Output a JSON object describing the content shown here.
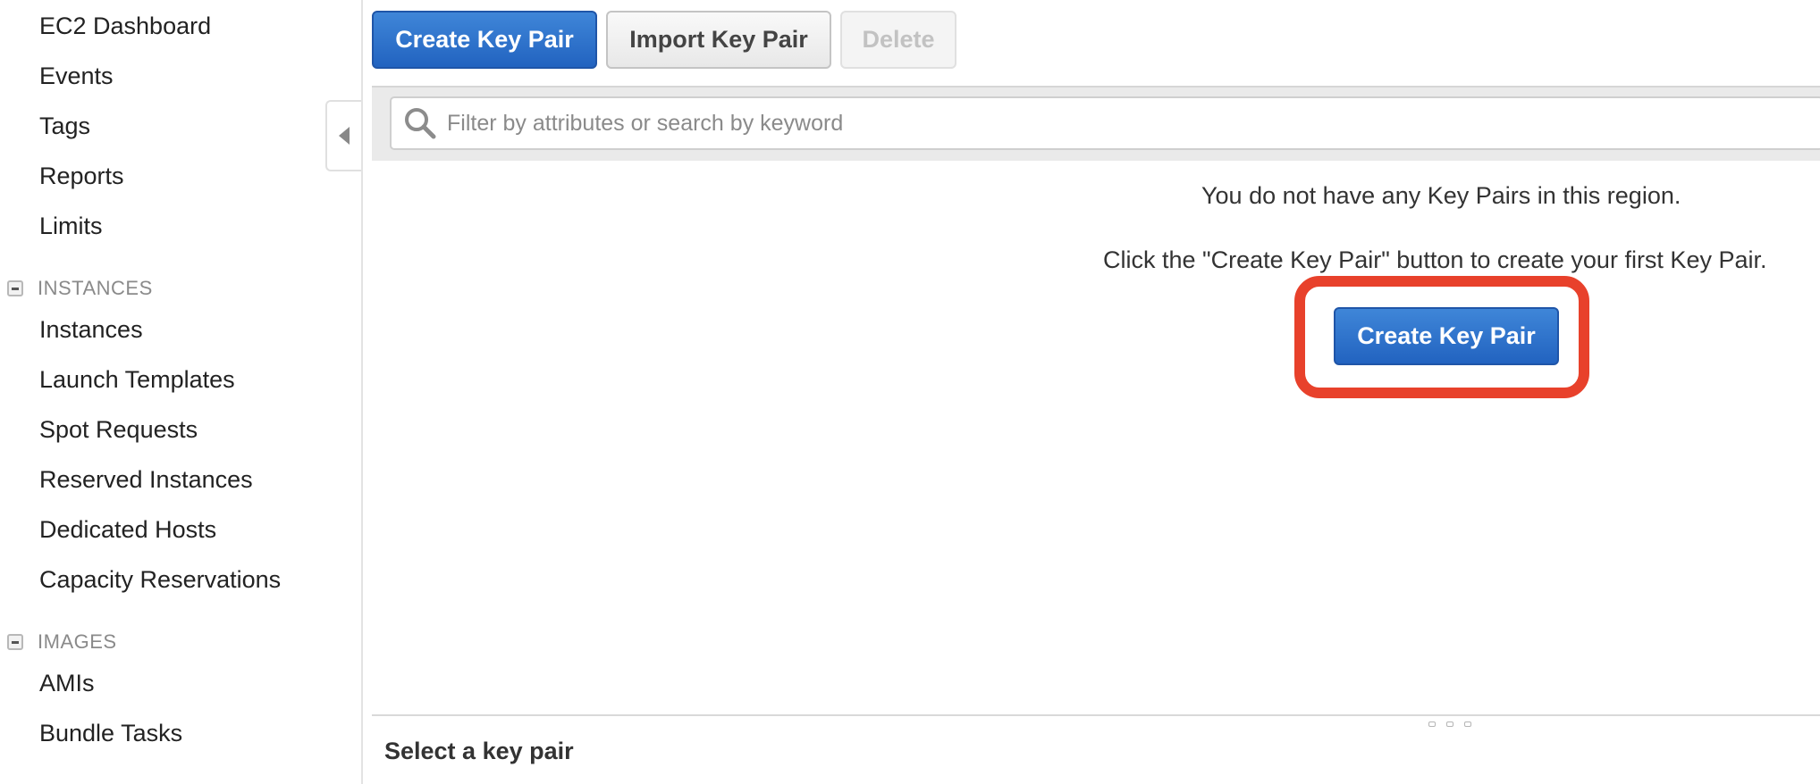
{
  "sidebar": {
    "items_top": [
      "EC2 Dashboard",
      "Events",
      "Tags",
      "Reports",
      "Limits"
    ],
    "instances_section": {
      "title": "INSTANCES",
      "items": [
        "Instances",
        "Launch Templates",
        "Spot Requests",
        "Reserved Instances",
        "Dedicated Hosts",
        "Capacity Reservations"
      ]
    },
    "images_section": {
      "title": "IMAGES",
      "items": [
        "AMIs",
        "Bundle Tasks"
      ]
    }
  },
  "toolbar": {
    "create_label": "Create Key Pair",
    "import_label": "Import Key Pair",
    "delete_label": "Delete"
  },
  "search": {
    "placeholder": "Filter by attributes or search by keyword"
  },
  "empty_state": {
    "message": "You do not have any Key Pairs in this region.",
    "hint": "Click the \"Create Key Pair\" button to create your first Key Pair.",
    "button_label": "Create Key Pair"
  },
  "detail": {
    "title": "Select a key pair"
  },
  "colors": {
    "primary": "#2d72cf",
    "highlight": "#e8412b"
  }
}
